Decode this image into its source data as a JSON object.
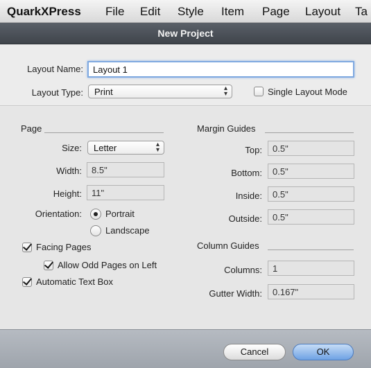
{
  "menubar": {
    "app": "QuarkXPress",
    "items": [
      "File",
      "Edit",
      "Style",
      "Item",
      "Page",
      "Layout",
      "Ta"
    ]
  },
  "dialog": {
    "title": "New Project"
  },
  "layout": {
    "name_label": "Layout Name:",
    "name_value": "Layout 1",
    "type_label": "Layout Type:",
    "type_value": "Print",
    "single_mode_label": "Single Layout Mode",
    "single_mode_checked": false
  },
  "page": {
    "section_title": "Page",
    "size_label": "Size:",
    "size_value": "Letter",
    "width_label": "Width:",
    "width_value": "8.5\"",
    "height_label": "Height:",
    "height_value": "11\"",
    "orientation_label": "Orientation:",
    "portrait_label": "Portrait",
    "landscape_label": "Landscape",
    "orientation_selected": "Portrait",
    "facing_pages_label": "Facing Pages",
    "allow_odd_label": "Allow Odd Pages on Left",
    "auto_text_box_label": "Automatic Text Box"
  },
  "margin_guides": {
    "section_title": "Margin Guides",
    "top_label": "Top:",
    "top_value": "0.5\"",
    "bottom_label": "Bottom:",
    "bottom_value": "0.5\"",
    "inside_label": "Inside:",
    "inside_value": "0.5\"",
    "outside_label": "Outside:",
    "outside_value": "0.5\""
  },
  "column_guides": {
    "section_title": "Column Guides",
    "columns_label": "Columns:",
    "columns_value": "1",
    "gutter_label": "Gutter Width:",
    "gutter_value": "0.167\""
  },
  "buttons": {
    "cancel": "Cancel",
    "ok": "OK"
  }
}
